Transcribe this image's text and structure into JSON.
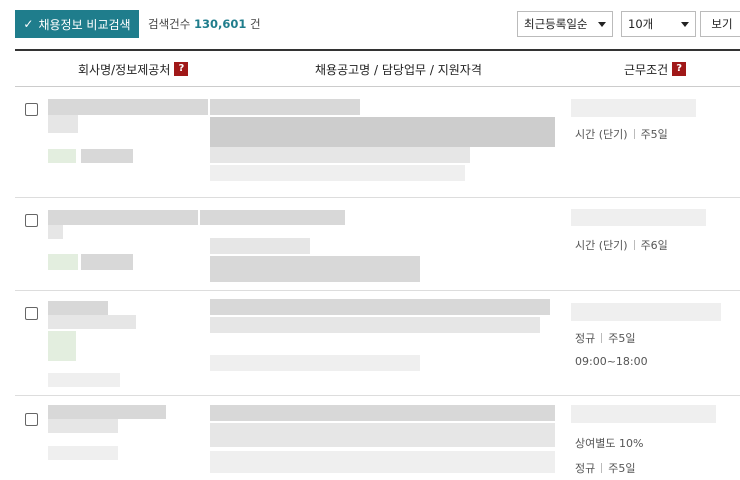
{
  "toolbar": {
    "compare_label": "채용정보 비교검색",
    "count_label": "검색건수",
    "count_value": "130,601",
    "count_unit": "건",
    "sort_selected": "최근등록일순",
    "per_page_selected": "10개",
    "view_label": "보기"
  },
  "table": {
    "headers": {
      "company": "회사명/정보제공처",
      "post": "채용공고명 / 담당업무 / 지원자격",
      "conditions": "근무조건"
    },
    "help_glyph": "?"
  },
  "rows": [
    {
      "cond_line1_a": "시간 (단기)",
      "cond_line1_b": "주5일",
      "cond_line2": ""
    },
    {
      "cond_line1_a": "시간 (단기)",
      "cond_line1_b": "주6일",
      "cond_line2": ""
    },
    {
      "cond_line1_a": "정규",
      "cond_line1_b": "주5일",
      "cond_line2": "09:00~18:00"
    },
    {
      "cond_line1_a": "상여별도 10%",
      "cond_line1_b": "",
      "cond_line2_a": "정규",
      "cond_line2_b": "주5일"
    }
  ],
  "colors": {
    "accent": "#1f7d8c",
    "help": "#a01818"
  }
}
